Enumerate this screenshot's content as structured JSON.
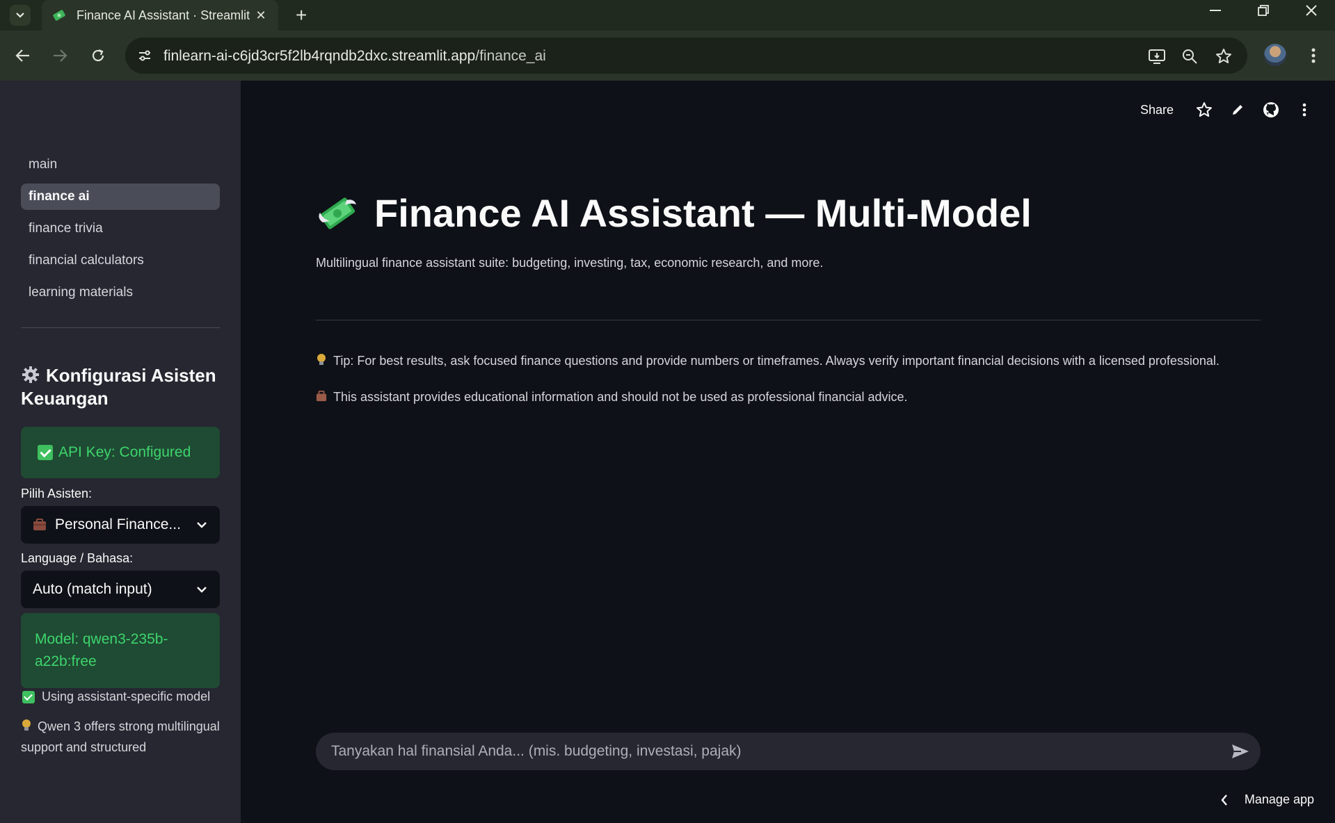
{
  "browser": {
    "tab_title": "Finance AI Assistant · Streamlit",
    "url_host": "finlearn-ai-c6jd3cr5f2lb4rqndb2dxc.streamlit.app",
    "url_path": "/finance_ai"
  },
  "sidebar": {
    "nav_items": [
      "main",
      "finance ai",
      "finance trivia",
      "financial calculators",
      "learning materials"
    ],
    "active_index": 1,
    "heading": "Konfigurasi Asisten Keuangan",
    "api_key_status": "API Key: Configured",
    "assistant_label": "Pilih Asisten:",
    "assistant_value": "Personal Finance...",
    "language_label": "Language / Bahasa:",
    "language_value": "Auto (match input)",
    "model_info": "Model: qwen3-235b-a22b:free",
    "model_check": "Using assistant-specific model",
    "qwen_note": "Qwen 3 offers strong multilingual support and structured"
  },
  "app_toolbar": {
    "share_label": "Share"
  },
  "main": {
    "title": "Finance AI Assistant — Multi-Model",
    "subtitle": "Multilingual finance assistant suite: budgeting, investing, tax, economic research, and more.",
    "tip": "Tip: For best results, ask focused finance questions and provide numbers or timeframes. Always verify important financial decisions with a licensed professional.",
    "disclaimer": "This assistant provides educational information and should not be used as professional financial advice.",
    "chat_placeholder": "Tanyakan hal finansial Anda... (mis. budgeting, investasi, pajak)",
    "manage_app": "Manage app"
  },
  "colors": {
    "success_bg": "#1f4a33",
    "success_text": "#3dd56d",
    "sidebar_bg": "#262730",
    "main_bg": "#0e1117"
  }
}
